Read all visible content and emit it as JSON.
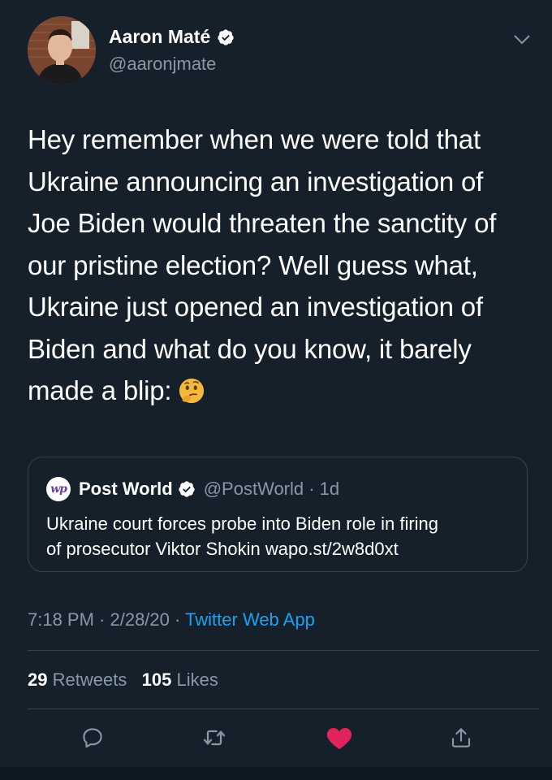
{
  "author": {
    "display_name": "Aaron Maté",
    "handle": "@aaronjmate",
    "verified": true
  },
  "tweet": {
    "lines": [
      "Hey remember when we were told that",
      "Ukraine announcing an investigation of",
      "Joe Biden would threaten the sanctity of",
      "our pristine election? Well guess what,",
      "Ukraine just opened an investigation of",
      "Biden and what do you know, it barely",
      "made a blip:"
    ],
    "emoji": "thinking-face-emoji"
  },
  "quoted_tweet": {
    "logo_text": "wp",
    "name": "Post World",
    "handle_time": "@PostWorld · 1d",
    "text_lines": [
      "Ukraine court forces probe into Biden role in firing",
      "of prosecutor Viktor Shokin wapo.st/2w8d0xt"
    ]
  },
  "meta": {
    "time_date": "7:18 PM · 2/28/20 · ",
    "source": "Twitter Web App"
  },
  "stats": {
    "retweets_count": "29",
    "retweets_label": "Retweets",
    "likes_count": "105",
    "likes_label": "Likes"
  },
  "actions": [
    "reply-icon",
    "retweet-icon",
    "like-icon",
    "share-icon"
  ],
  "colors": {
    "background": "#15202b",
    "secondary_text": "#8899a6",
    "accent": "#1da1f2",
    "like": "#e0245e",
    "divider": "#38444d"
  }
}
